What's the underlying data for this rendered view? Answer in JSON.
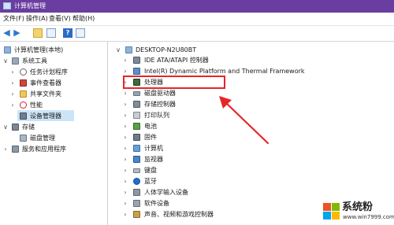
{
  "window": {
    "title": "计算机管理"
  },
  "menu": [
    "文件(F)",
    "操作(A)",
    "查看(V)",
    "帮助(H)"
  ],
  "left_tree": [
    {
      "label": "计算机管理(本地)",
      "icon": "computer-management-icon"
    },
    {
      "label": "系统工具",
      "icon": "tools-icon"
    },
    {
      "label": "任务计划程序",
      "icon": "clock-icon"
    },
    {
      "label": "事件查看器",
      "icon": "event-viewer-icon"
    },
    {
      "label": "共享文件夹",
      "icon": "shared-folder-icon"
    },
    {
      "label": "性能",
      "icon": "performance-icon"
    },
    {
      "label": "设备管理器",
      "icon": "device-manager-icon"
    },
    {
      "label": "存储",
      "icon": "storage-icon"
    },
    {
      "label": "磁盘管理",
      "icon": "disk-management-icon"
    },
    {
      "label": "服务和应用程序",
      "icon": "services-icon"
    }
  ],
  "device_tree": {
    "root": "DESKTOP-N2U80BT",
    "items": [
      "IDE ATA/ATAPI 控制器",
      "Intel(R) Dynamic Platform and Thermal Framework",
      "处理器",
      "磁盘驱动器",
      "存储控制器",
      "打印队列",
      "电池",
      "固件",
      "计算机",
      "监视器",
      "键盘",
      "蓝牙",
      "人体学输入设备",
      "软件设备",
      "声音、视频和游戏控制器"
    ]
  },
  "watermark": {
    "brand": "系统粉",
    "url": "www.win7999.com"
  },
  "colors": {
    "titlebar": "#6a3ea1",
    "highlight": "#e5262a",
    "selection": "#cce4f7"
  }
}
